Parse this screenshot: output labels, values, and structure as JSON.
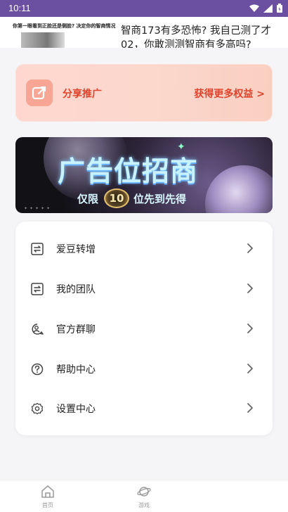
{
  "status_bar": {
    "time": "10:11"
  },
  "ad": {
    "small_text": "你第一眼看到正脸还是侧脸? 决定你的智商情况",
    "headline": "智商173有多恐怖? 我自己测了才02，你敢测测智商有多高吗?"
  },
  "share": {
    "label": "分享推广",
    "more": "获得更多权益 >"
  },
  "banner": {
    "title": "广告位招商",
    "sub_prefix": "仅限",
    "badge": "10",
    "sub_suffix": "位先到先得",
    "dots": "✦✦✦✦✦"
  },
  "menu": {
    "items": [
      {
        "label": "爱豆转增",
        "icon": "transfer-icon"
      },
      {
        "label": "我的团队",
        "icon": "team-icon"
      },
      {
        "label": "官方群聊",
        "icon": "group-chat-icon"
      },
      {
        "label": "帮助中心",
        "icon": "help-icon"
      },
      {
        "label": "设置中心",
        "icon": "settings-icon"
      }
    ]
  },
  "tabs": [
    {
      "label": "首页",
      "icon": "home-icon"
    },
    {
      "label": "游戏",
      "icon": "planet-icon"
    }
  ],
  "colors": {
    "status_bar": "#6b4fa0",
    "accent": "#e0422b",
    "share_bg": "#ffd7cf"
  }
}
